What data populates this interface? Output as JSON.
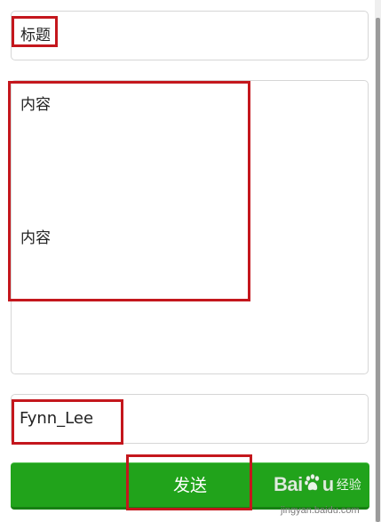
{
  "form": {
    "title_value": "标题",
    "content_line1": "内容",
    "content_line2": "内容",
    "author_value": "Fynn_Lee",
    "send_label": "发送"
  },
  "watermark": {
    "logo_left": "Bai",
    "logo_right": "u",
    "brand": "经验",
    "domain": "jingyan.baidu.com",
    "icon": "paw-icon"
  },
  "colors": {
    "send_button_bg": "#21a31b",
    "highlight_border": "#c4171d",
    "field_border": "#d6d6d6"
  }
}
